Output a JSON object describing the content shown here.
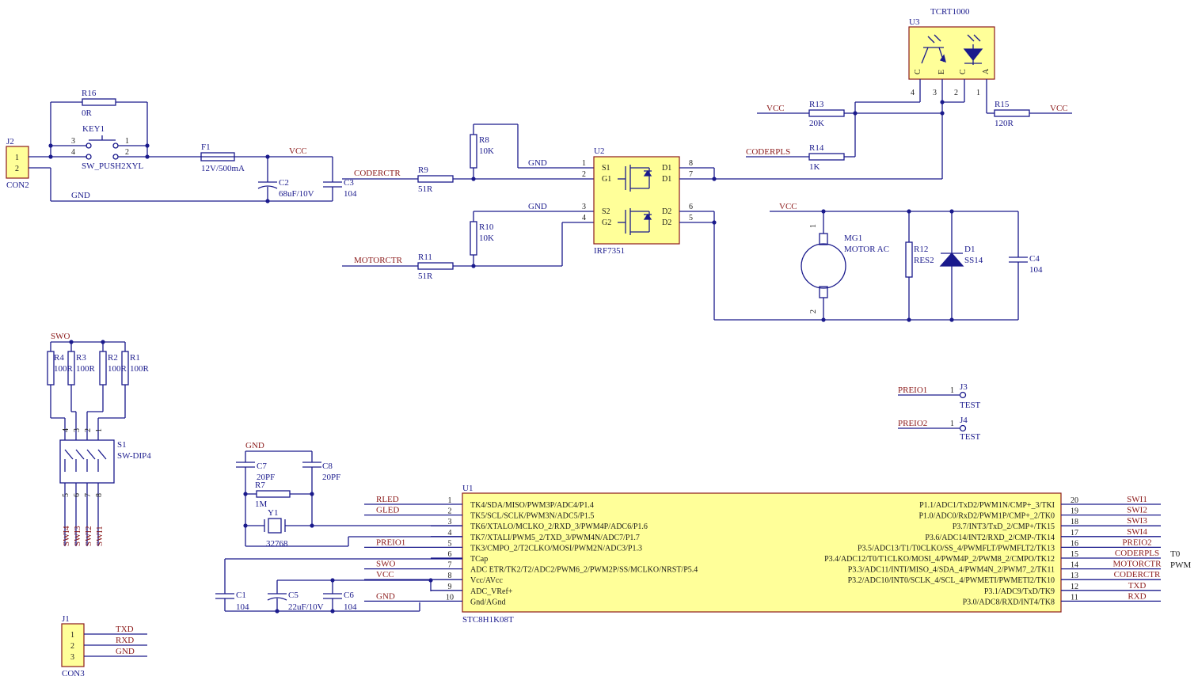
{
  "colors": {
    "wire": "#1a1a8c",
    "body_fill": "#ffff99",
    "body_stroke": "#8b1a1a",
    "net_label": "#8b1a1a"
  },
  "power": {
    "j2": {
      "designator": "J2",
      "value": "CON2",
      "pins": [
        "1",
        "2"
      ]
    },
    "r16": {
      "designator": "R16",
      "value": "0R"
    },
    "key1": {
      "designator": "KEY1",
      "value": "SW_PUSH2XYL",
      "pins": [
        "3",
        "4",
        "1",
        "2"
      ]
    },
    "f1": {
      "designator": "F1",
      "value": "12V/500mA"
    },
    "c2": {
      "designator": "C2",
      "value": "68uF/10V"
    },
    "c3": {
      "designator": "C3",
      "value": "104"
    },
    "vcc": "VCC",
    "gnd": "GND"
  },
  "mosfet": {
    "u2": {
      "designator": "U2",
      "value": "IRF7351"
    },
    "pin_names_left": [
      "S1",
      "G1",
      "S2",
      "G2"
    ],
    "pin_names_right": [
      "D1",
      "D1",
      "D2",
      "D2"
    ],
    "pins_left": [
      "1",
      "2",
      "3",
      "4"
    ],
    "pins_right": [
      "8",
      "7",
      "6",
      "5"
    ],
    "r8": {
      "designator": "R8",
      "value": "10K"
    },
    "r9": {
      "designator": "R9",
      "value": "51R"
    },
    "r10": {
      "designator": "R10",
      "value": "10K"
    },
    "r11": {
      "designator": "R11",
      "value": "51R"
    },
    "coderctr": "CODERCTR",
    "motorctr": "MOTORCTR",
    "gnd1": "GND",
    "gnd2": "GND"
  },
  "sensor": {
    "u3": {
      "designator": "U3",
      "value": "TCRT1000"
    },
    "pin_letters": [
      "C",
      "E",
      "C",
      "A"
    ],
    "pins": [
      "4",
      "3",
      "2",
      "1"
    ],
    "r13": {
      "designator": "R13",
      "value": "20K"
    },
    "r14": {
      "designator": "R14",
      "value": "1K"
    },
    "r15": {
      "designator": "R15",
      "value": "120R"
    },
    "vcc_left": "VCC",
    "vcc_right": "VCC",
    "coderpls": "CODERPLS"
  },
  "motor": {
    "mg1": {
      "designator": "MG1",
      "value": "MOTOR AC",
      "pins": [
        "1",
        "2"
      ]
    },
    "r12": {
      "designator": "R12",
      "value": "RES2"
    },
    "d1": {
      "designator": "D1",
      "value": "SS14"
    },
    "c4": {
      "designator": "C4",
      "value": "104"
    },
    "vcc": "VCC"
  },
  "dip": {
    "swo": "SWO",
    "r4": {
      "designator": "R4",
      "value": "100R"
    },
    "r3": {
      "designator": "R3",
      "value": "100R"
    },
    "r2": {
      "designator": "R2",
      "value": "100R"
    },
    "r1": {
      "designator": "R1",
      "value": "100R"
    },
    "s1": {
      "designator": "S1",
      "value": "SW-DIP4"
    },
    "pins_top": [
      "4",
      "3",
      "2",
      "1"
    ],
    "pins_bottom": [
      "5",
      "6",
      "7",
      "8"
    ],
    "nets": [
      "SWI4",
      "SWI3",
      "SWI2",
      "SWI1"
    ]
  },
  "tests": {
    "j3": {
      "designator": "J3",
      "value": "TEST",
      "net": "PREIO1",
      "pin": "1"
    },
    "j4": {
      "designator": "J4",
      "value": "TEST",
      "net": "PREIO2",
      "pin": "1"
    }
  },
  "crystal": {
    "gnd": "GND",
    "c7": {
      "designator": "C7",
      "value": "20PF"
    },
    "c8": {
      "designator": "C8",
      "value": "20PF"
    },
    "r7": {
      "designator": "R7",
      "value": "1M"
    },
    "y1": {
      "designator": "Y1",
      "value": "32768"
    }
  },
  "mcu": {
    "u1": {
      "designator": "U1",
      "value": "STC8H1K08T"
    },
    "left_pins": [
      {
        "no": "1",
        "name": "TK4/SDA/MISO/PWM3P/ADC4/P1.4",
        "net": "RLED"
      },
      {
        "no": "2",
        "name": "TK5/SCL/SCLK/PWM3N/ADC5/P1.5",
        "net": "GLED"
      },
      {
        "no": "3",
        "name": "TK6/XTALO/MCLKO_2/RXD_3/PWM4P/ADC6/P1.6",
        "net": ""
      },
      {
        "no": "4",
        "name": "TK7/XTALI/PWM5_2/TXD_3/PWM4N/ADC7/P1.7",
        "net": ""
      },
      {
        "no": "5",
        "name": "TK3/CMPO_2/T2CLKO/MOSI/PWM2N/ADC3/P1.3",
        "net": "PREIO1"
      },
      {
        "no": "6",
        "name": "TCap",
        "net": ""
      },
      {
        "no": "7",
        "name": "ADC ETR/TK2/T2/ADC2/PWM6_2/PWM2P/SS/MCLKO/NRST/P5.4",
        "net": "SWO"
      },
      {
        "no": "8",
        "name": "Vcc/AVcc",
        "net": "VCC"
      },
      {
        "no": "9",
        "name": "ADC_VRef+",
        "net": ""
      },
      {
        "no": "10",
        "name": "Gnd/AGnd",
        "net": "GND"
      }
    ],
    "right_pins": [
      {
        "no": "20",
        "name": "P1.1/ADC1/TxD2/PWM1N/CMP+_3/TKI",
        "net": "SWI1"
      },
      {
        "no": "19",
        "name": "P1.0/ADC0/RxD2/PWM1P/CMP+_2/TK0",
        "net": "SWI2"
      },
      {
        "no": "18",
        "name": "P3.7/INT3/TxD_2/CMP+/TK15",
        "net": "SWI3"
      },
      {
        "no": "17",
        "name": "P3.6/ADC14/INT2/RXD_2/CMP-/TK14",
        "net": "SWI4"
      },
      {
        "no": "16",
        "name": "P3.5/ADC13/T1/T0CLKO/SS_4/PWMFLT/PWMFLT2/TK13",
        "net": "PREIO2"
      },
      {
        "no": "15",
        "name": "P3.4/ADC12/T0/T1CLKO/MOSI_4/PWM4P_2/PWM8_2/CMPO/TK12",
        "net": "CODERPLS"
      },
      {
        "no": "14",
        "name": "P3.3/ADC11/INTI/MISO_4/SDA_4/PWM4N_2/PWM7_2/TK11",
        "net": "MOTORCTR"
      },
      {
        "no": "13",
        "name": "P3.2/ADC10/INT0/SCLK_4/SCL_4/PWMETI/PWMETI2/TK10",
        "net": "CODERCTR"
      },
      {
        "no": "12",
        "name": "P3.1/ADC9/TxD/TK9",
        "net": "TXD"
      },
      {
        "no": "11",
        "name": "P3.0/ADC8/RXD/INT4/TK8",
        "net": "RXD"
      }
    ],
    "side_notes": [
      "T0",
      "PWM"
    ],
    "c1": {
      "designator": "C1",
      "value": "104"
    },
    "c5": {
      "designator": "C5",
      "value": "22uF/10V"
    },
    "c6": {
      "designator": "C6",
      "value": "104"
    }
  },
  "uart": {
    "j1": {
      "designator": "J1",
      "value": "CON3"
    },
    "pins": [
      "1",
      "2",
      "3"
    ],
    "nets": [
      "TXD",
      "RXD",
      "GND"
    ]
  }
}
